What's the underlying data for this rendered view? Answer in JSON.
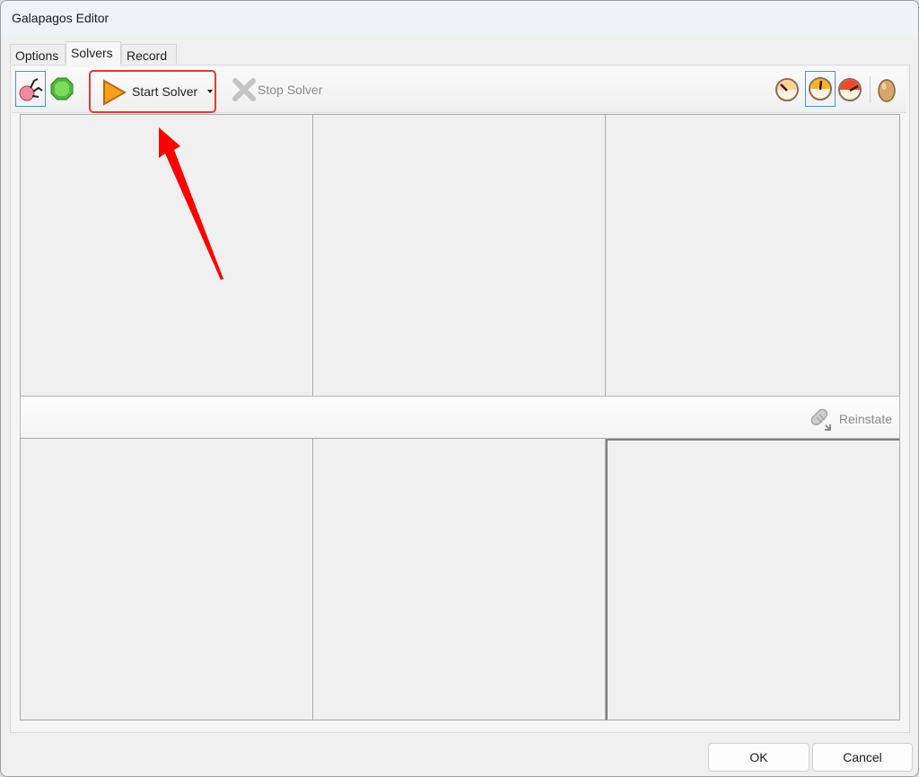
{
  "window": {
    "title": "Galapagos Editor"
  },
  "tabs": [
    {
      "label": "Options",
      "active": false
    },
    {
      "label": "Solvers",
      "active": true
    },
    {
      "label": "Record",
      "active": false
    }
  ],
  "toolbar": {
    "genetic_solver_icon": "genetic-evolution-icon",
    "annealing_solver_icon": "green-gem-icon",
    "start_label": "Start Solver",
    "stop_label": "Stop Solver",
    "speed_buttons": [
      {
        "name": "speed-slow",
        "selected": false
      },
      {
        "name": "speed-medium",
        "selected": true
      },
      {
        "name": "speed-fast",
        "selected": false
      }
    ],
    "egg_icon": "egg-icon"
  },
  "mid_bar": {
    "reinstate_label": "Reinstate"
  },
  "footer": {
    "ok_label": "OK",
    "cancel_label": "Cancel"
  },
  "annotation": {
    "color": "#ff0000",
    "highlight_color": "#e53935"
  }
}
